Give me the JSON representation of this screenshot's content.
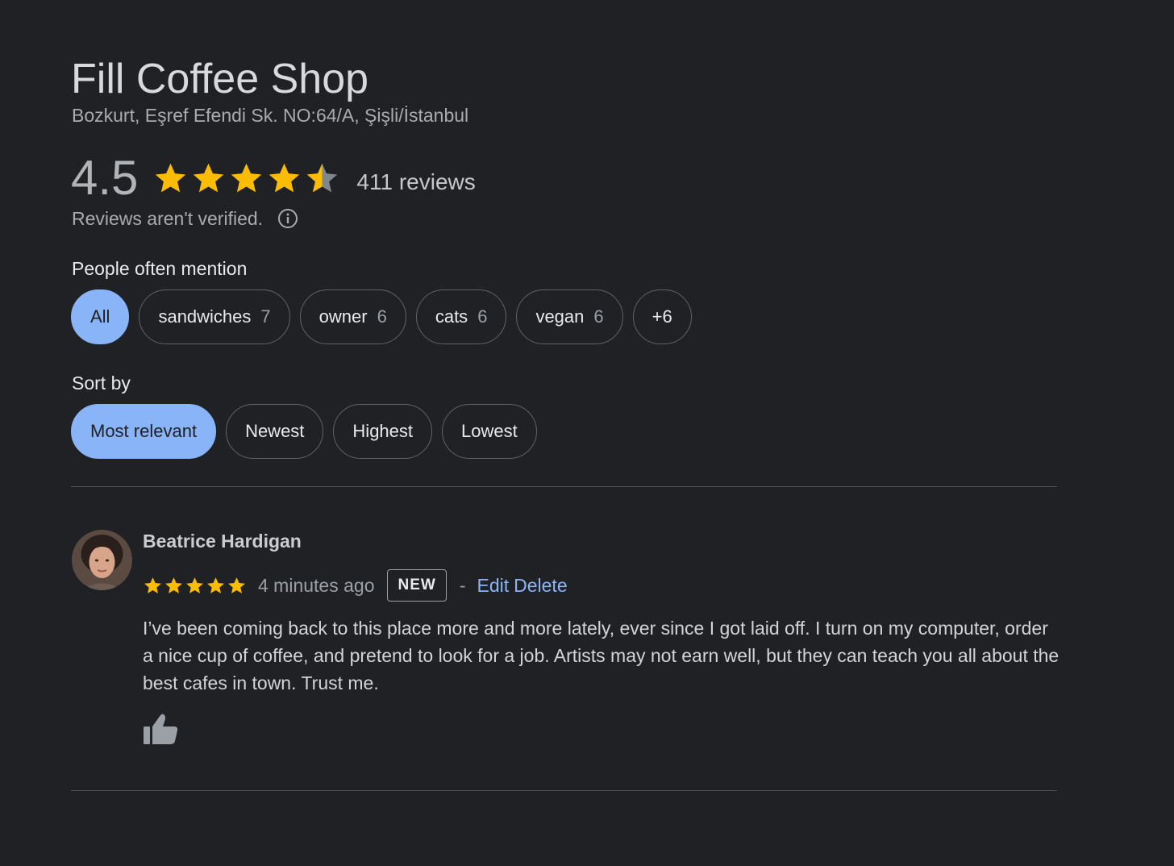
{
  "place": {
    "name": "Fill Coffee Shop",
    "address": "Bozkurt, Eşref Efendi Sk. NO:64/A, Şişli/İstanbul",
    "rating": "4.5",
    "rating_value": 4.5,
    "rating_max": 5,
    "review_count": "411 reviews",
    "verification_note": "Reviews aren't verified."
  },
  "colors": {
    "star": "#fbbc04",
    "star_empty": "#80868b",
    "accent": "#8ab4f8",
    "background": "#202124"
  },
  "mentions": {
    "label": "People often mention",
    "chips": [
      {
        "label": "All",
        "count": "",
        "selected": true
      },
      {
        "label": "sandwiches",
        "count": "7",
        "selected": false
      },
      {
        "label": "owner",
        "count": "6",
        "selected": false
      },
      {
        "label": "cats",
        "count": "6",
        "selected": false
      },
      {
        "label": "vegan",
        "count": "6",
        "selected": false
      },
      {
        "label": "+6",
        "count": "",
        "selected": false
      }
    ]
  },
  "sort": {
    "label": "Sort by",
    "options": [
      {
        "label": "Most relevant",
        "selected": true
      },
      {
        "label": "Newest",
        "selected": false
      },
      {
        "label": "Highest",
        "selected": false
      },
      {
        "label": "Lowest",
        "selected": false
      }
    ]
  },
  "review": {
    "author": "Beatrice Hardigan",
    "stars": 5,
    "time": "4 minutes ago",
    "badge": "NEW",
    "separator": "-",
    "edit_label": "Edit",
    "delete_label": "Delete",
    "text": "I’ve been coming back to this place more and more lately, ever since I got laid off. I turn on my computer, order a nice cup of coffee, and pretend to look for a job. Artists may not earn well, but they can teach you all about the best cafes in town. Trust me.",
    "avatar_icon": "person-avatar",
    "like_icon": "thumbs-up-icon"
  }
}
